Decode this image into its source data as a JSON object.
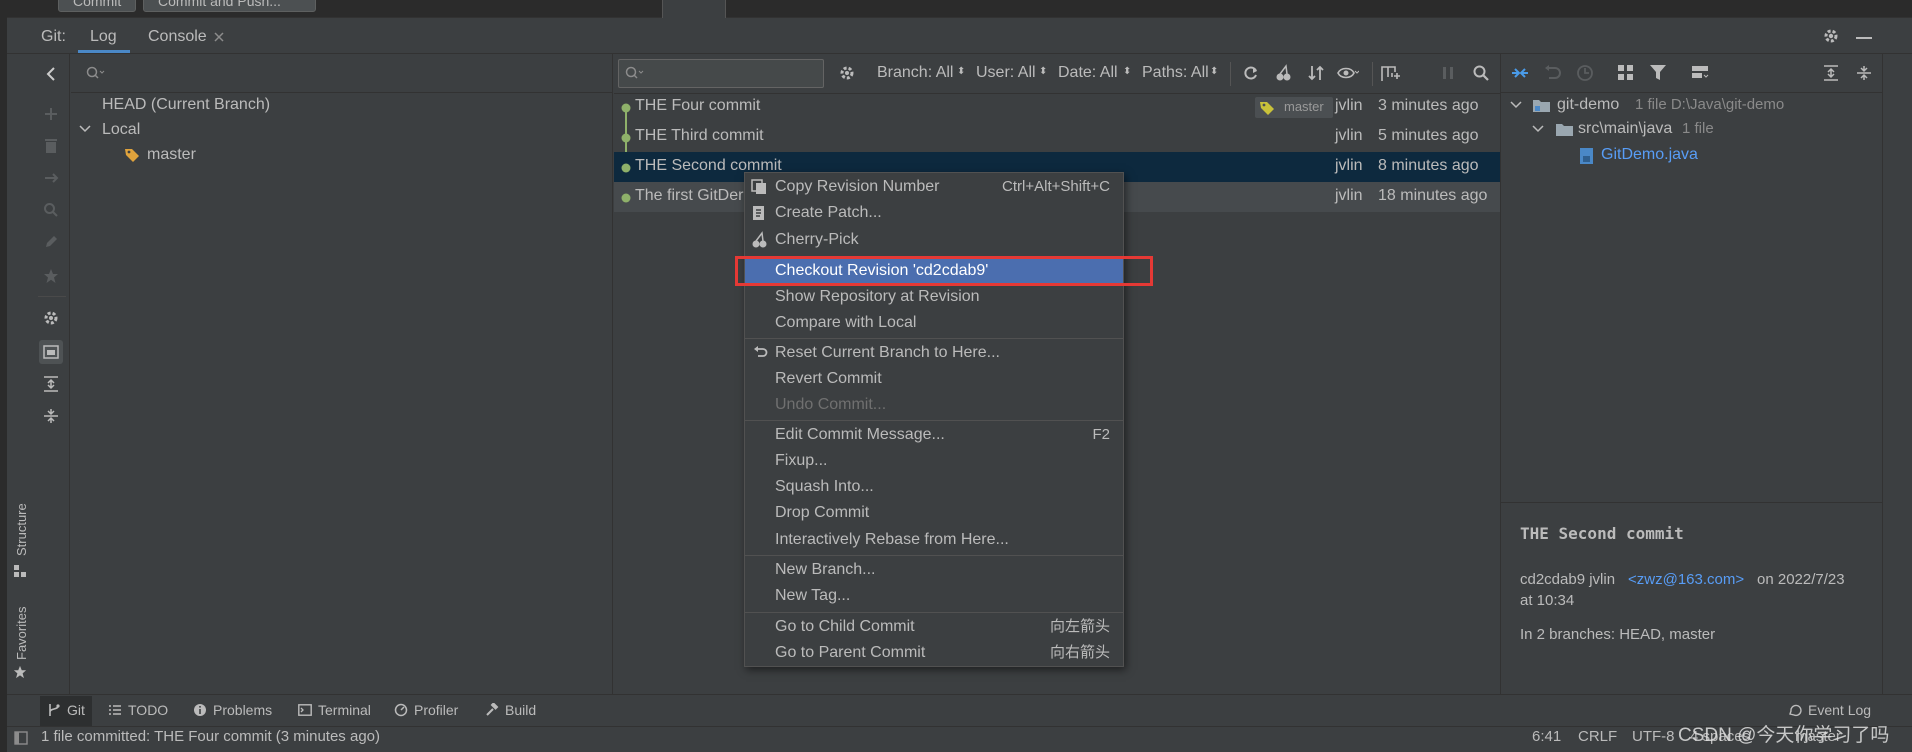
{
  "top": {
    "commit_label": "Commit",
    "commit_push_label": "Commit and Push..."
  },
  "git_header": {
    "prefix": "Git:",
    "tabs": [
      {
        "label": "Log"
      },
      {
        "label": "Console"
      }
    ]
  },
  "branches": {
    "head": "HEAD (Current Branch)",
    "local_group": "Local",
    "local_items": [
      {
        "label": "master"
      }
    ]
  },
  "log_toolbar": {
    "search_placeholder": "",
    "filters": [
      {
        "label": "Branch: All"
      },
      {
        "label": "User: All"
      },
      {
        "label": "Date: All"
      },
      {
        "label": "Paths: All"
      }
    ]
  },
  "commits": [
    {
      "message": "THE Four commit",
      "tag": "master",
      "author": "jvlin",
      "time": "3 minutes ago"
    },
    {
      "message": "THE Third commit",
      "author": "jvlin",
      "time": "5 minutes ago"
    },
    {
      "message": "THE Second commit",
      "author": "jvlin",
      "time": "8 minutes ago"
    },
    {
      "message": "The first GitDer",
      "author": "jvlin",
      "time": "18 minutes ago"
    }
  ],
  "changes_tree": {
    "root": {
      "name": "git-demo",
      "meta": "1 file  D:\\Java\\git-demo"
    },
    "folder": {
      "name": "src\\main\\java",
      "meta": "1 file"
    },
    "file": {
      "name": "GitDemo.java"
    }
  },
  "commit_details": {
    "title": "THE Second commit",
    "hash_author": "cd2cdab9 jvlin",
    "email": "<zwz@163.com>",
    "date_prefix": "on 2022/7/23",
    "time_line": "at 10:34",
    "branches": "In 2 branches: HEAD, master"
  },
  "context_menu": {
    "items": [
      {
        "label": "Copy Revision Number",
        "shortcut": "Ctrl+Alt+Shift+C",
        "icon": "copy-icon"
      },
      {
        "label": "Create Patch...",
        "icon": "patch-icon"
      },
      {
        "label": "Cherry-Pick",
        "icon": "cherry-icon"
      },
      {
        "label": "Checkout Revision 'cd2cdab9'"
      },
      {
        "label": "Show Repository at Revision"
      },
      {
        "label": "Compare with Local"
      },
      {
        "label": "Reset Current Branch to Here...",
        "icon": "undo-icon"
      },
      {
        "label": "Revert Commit"
      },
      {
        "label": "Undo Commit..."
      },
      {
        "label": "Edit Commit Message...",
        "shortcut": "F2"
      },
      {
        "label": "Fixup..."
      },
      {
        "label": "Squash Into..."
      },
      {
        "label": "Drop Commit"
      },
      {
        "label": "Interactively Rebase from Here..."
      },
      {
        "label": "New Branch..."
      },
      {
        "label": "New Tag..."
      },
      {
        "label": "Go to Child Commit",
        "shortcut": "向左箭头"
      },
      {
        "label": "Go to Parent Commit",
        "shortcut": "向右箭头"
      }
    ]
  },
  "side_labels": {
    "structure": "Structure",
    "favorites": "Favorites"
  },
  "bottom_tabs": [
    {
      "label": "Git"
    },
    {
      "label": "TODO"
    },
    {
      "label": "Problems"
    },
    {
      "label": "Terminal"
    },
    {
      "label": "Profiler"
    },
    {
      "label": "Build"
    }
  ],
  "event_log": "Event Log",
  "status_bar": {
    "message": "1 file committed: THE Four commit (3 minutes ago)",
    "position": "6:41",
    "line_ending": "CRLF",
    "encoding": "UTF-8",
    "indent": "4 spaces",
    "branch": "master"
  },
  "watermark": "CSDN @今天你学习了吗",
  "colors": {
    "accent": "#4a88c7",
    "selection": "#4b6eaf",
    "highlight_box": "#e53935",
    "graph": "#8fb16a",
    "link": "#589df6"
  }
}
